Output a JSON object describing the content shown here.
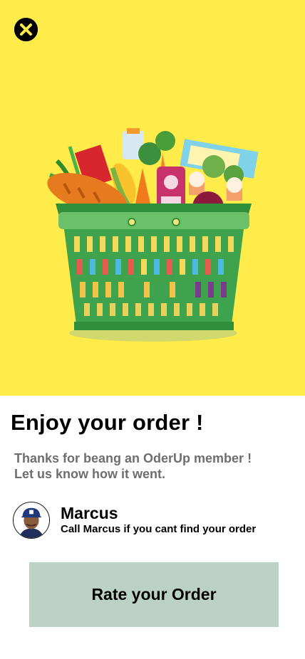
{
  "hero": {
    "background": "#FFEC4A",
    "close_icon": "close-circle-icon",
    "illustration": "grocery-basket"
  },
  "main": {
    "title": "Enjoy your order !",
    "subtitle_line1": "Thanks for beang an OderUp member !",
    "subtitle_line2": "Let us know how it went."
  },
  "contact": {
    "name": "Marcus",
    "hint": "Call Marcus if you cant find your order",
    "avatar_icon": "shopper-avatar"
  },
  "actions": {
    "rate_label": "Rate your Order",
    "rate_color": "#BCD1C6"
  }
}
